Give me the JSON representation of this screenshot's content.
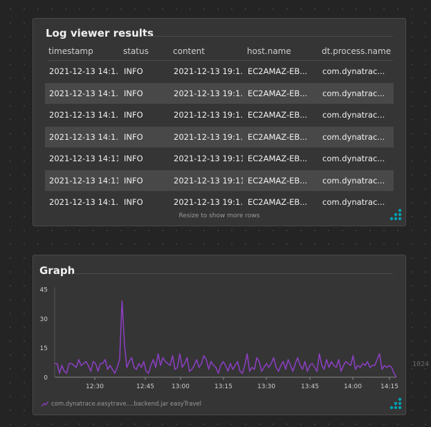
{
  "log_tile": {
    "title": "Log viewer results",
    "columns": [
      "timestamp",
      "status",
      "content",
      "host.name",
      "dt.process.name"
    ],
    "rows": [
      [
        "2021-12-13 14:1...",
        "INFO",
        "2021-12-13 19:1...",
        "EC2AMAZ-EB...",
        "com.dynatrac..."
      ],
      [
        "2021-12-13 14:1...",
        "INFO",
        "2021-12-13 19:1...",
        "EC2AMAZ-EB...",
        "com.dynatrac..."
      ],
      [
        "2021-12-13 14:1...",
        "INFO",
        "2021-12-13 19:1...",
        "EC2AMAZ-EB...",
        "com.dynatrac..."
      ],
      [
        "2021-12-13 14:1...",
        "INFO",
        "2021-12-13 19:1...",
        "EC2AMAZ-EB...",
        "com.dynatrac..."
      ],
      [
        "2021-12-13 14:11...",
        "INFO",
        "2021-12-13 19:11...",
        "EC2AMAZ-EB...",
        "com.dynatrac..."
      ],
      [
        "2021-12-13 14:11...",
        "INFO",
        "2021-12-13 19:11...",
        "EC2AMAZ-EB...",
        "com.dynatrac..."
      ],
      [
        "2021-12-13 14:1...",
        "INFO",
        "2021-12-13 19:1...",
        "EC2AMAZ-EB...",
        "com.dynatrac..."
      ]
    ],
    "footer_hint": "Resize to show more rows",
    "resize_icon": "resize-grip-icon"
  },
  "graph_tile": {
    "title": "Graph",
    "resize_icon": "resize-grip-icon"
  },
  "stray_text": "1024",
  "colors": {
    "line": "#8a3fc0",
    "accent": "#00a1b2",
    "tile_bg": "#353535",
    "page_bg": "#242424"
  },
  "chart_data": {
    "type": "line",
    "title": "Graph",
    "xlabel": "",
    "ylabel": "",
    "x_tick_labels": [
      "12:30",
      "12:45",
      "13:00",
      "13:15",
      "13:30",
      "13:45",
      "14:00",
      "14:15"
    ],
    "y_ticks": [
      0,
      15,
      30,
      45
    ],
    "ylim": [
      0,
      45
    ],
    "grid": false,
    "legend_position": "bottom-left",
    "series": [
      {
        "name": "com.dynatrace.easytrave....backend.jar easyTravel",
        "color": "#8a3fc0",
        "values": [
          7,
          7,
          2,
          6,
          3,
          2,
          7,
          7,
          6,
          5,
          9,
          6,
          7,
          8,
          6,
          3,
          8,
          7,
          3,
          7,
          7,
          9,
          4,
          6,
          4,
          2,
          5,
          9,
          39,
          17,
          5,
          8,
          10,
          5,
          4,
          7,
          5,
          8,
          3,
          2,
          6,
          9,
          5,
          12,
          6,
          10,
          8,
          7,
          6,
          11,
          4,
          5,
          12,
          5,
          7,
          10,
          3,
          4,
          6,
          9,
          5,
          7,
          11,
          9,
          4,
          8,
          6,
          5,
          2,
          6,
          8,
          6,
          3,
          7,
          4,
          6,
          8,
          3,
          2,
          6,
          12,
          3,
          5,
          4,
          10,
          8,
          3,
          5,
          7,
          5,
          7,
          10,
          5,
          3,
          6,
          8,
          4,
          9,
          6,
          3,
          7,
          10,
          6,
          4,
          8,
          3,
          6,
          7,
          5,
          3,
          12,
          6,
          4,
          9,
          5,
          8,
          6,
          5,
          9,
          3,
          6,
          8,
          7,
          6,
          11,
          4,
          6,
          5,
          7,
          6,
          8,
          5,
          6,
          6,
          9,
          12,
          4,
          6,
          5,
          6,
          5,
          2,
          0
        ]
      }
    ]
  }
}
